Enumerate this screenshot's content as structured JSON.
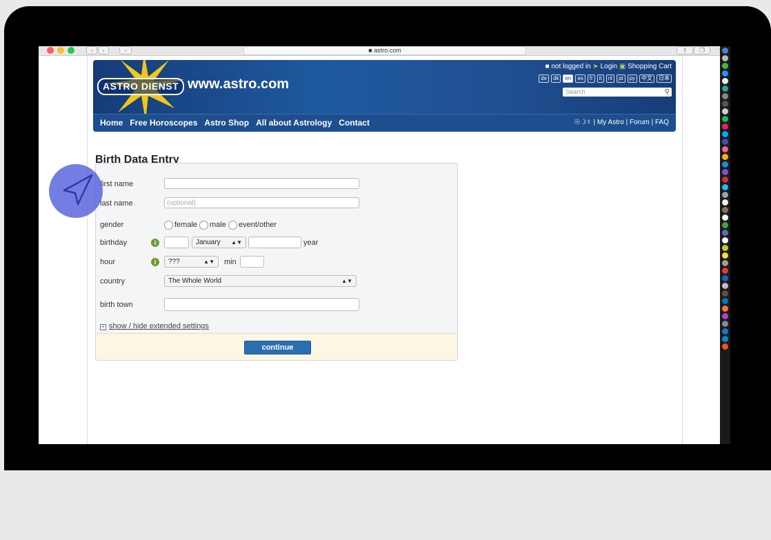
{
  "browser": {
    "url": "astro.com",
    "back_icon": "chevron-left-icon",
    "forward_icon": "chevron-right-icon"
  },
  "site": {
    "logo_text": "ASTRO DIENST",
    "logo_url": "www.astro.com",
    "login_status": "not logged in",
    "login_label": "Login",
    "cart_label": "Shopping Cart",
    "languages": [
      "de",
      "dk",
      "en",
      "es",
      "fr",
      "it",
      "nl",
      "pt",
      "ру",
      "中文",
      "日本"
    ],
    "active_language": "en",
    "search_placeholder": "Search"
  },
  "nav": {
    "items": [
      "Home",
      "Free Horoscopes",
      "Astro Shop",
      "All about Astrology",
      "Contact"
    ],
    "right": "☉☽☿ | My Astro | Forum | FAQ"
  },
  "page": {
    "title": "Birth Data Entry"
  },
  "form": {
    "first_name_label": "first name",
    "last_name_label": "last name",
    "last_name_placeholder": "(optional)",
    "gender_label": "gender",
    "gender_options": [
      "female",
      "male",
      "event/other"
    ],
    "birthday_label": "birthday",
    "month_value": "January",
    "year_label": "year",
    "hour_label": "hour",
    "hour_value": "???",
    "min_label": "min",
    "country_label": "country",
    "country_value": "The Whole World",
    "birth_town_label": "birth town",
    "extended_settings": "show / hide extended settings",
    "continue_label": "continue",
    "info_icon": "info-icon"
  },
  "colors": {
    "banner": "#1e4e8e",
    "continue": "#2a6fb0",
    "info": "#6d9c2e",
    "footer": "#fdf6e3"
  }
}
